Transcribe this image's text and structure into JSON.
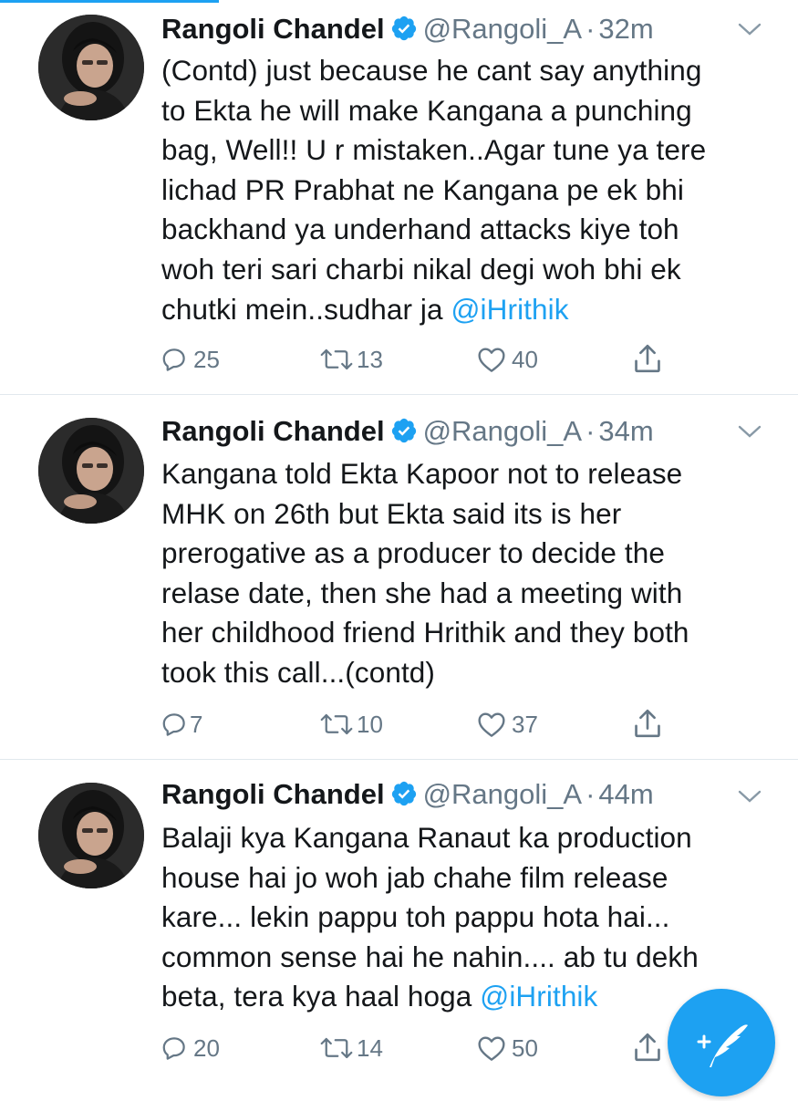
{
  "tweets": [
    {
      "author_name": "Rangoli Chandel",
      "handle": "@Rangoli_A",
      "separator": "·",
      "time": "32m",
      "lines": [
        "(Contd) just because he cant say anything",
        "to Ekta he will make Kangana a punching",
        "bag, Well!! U r mistaken..Agar tune ya tere",
        "lichad PR Prabhat ne Kangana pe ek bhi",
        "backhand ya underhand attacks kiye toh",
        "woh teri sari charbi nikal degi woh bhi ek"
      ],
      "last_line": "chutki mein..sudhar ja ",
      "mention": "@iHrithik",
      "replies": "25",
      "retweets": "13",
      "likes": "40"
    },
    {
      "author_name": "Rangoli Chandel",
      "handle": "@Rangoli_A",
      "separator": "·",
      "time": "34m",
      "lines": [
        "Kangana told Ekta Kapoor not to release",
        "MHK on 26th but Ekta said its is her",
        "prerogative as a producer to decide the",
        "relase date, then she had a meeting with",
        "her childhood friend Hrithik and they both",
        "took this call...(contd)"
      ],
      "last_line": "",
      "mention": "",
      "replies": "7",
      "retweets": "10",
      "likes": "37"
    },
    {
      "author_name": "Rangoli Chandel",
      "handle": "@Rangoli_A",
      "separator": "·",
      "time": "44m",
      "lines": [
        "Balaji kya Kangana Ranaut ka production",
        "house hai jo woh jab chahe film release",
        "kare... lekin pappu toh pappu hota hai...",
        "common sense hai he nahin.... ab tu dekh"
      ],
      "last_line": "beta, tera kya haal hoga ",
      "mention": "@iHrithik",
      "replies": "20",
      "retweets": "14",
      "likes": "50"
    }
  ],
  "colors": {
    "accent": "#1da1f2",
    "text": "#14171a",
    "secondary": "#657786",
    "divider": "#e1e8ed"
  },
  "icons": {
    "reply": "reply-icon",
    "retweet": "retweet-icon",
    "like": "heart-icon",
    "share": "share-icon",
    "verified": "verified-badge-icon",
    "more": "chevron-down-icon",
    "compose": "compose-tweet-icon"
  }
}
